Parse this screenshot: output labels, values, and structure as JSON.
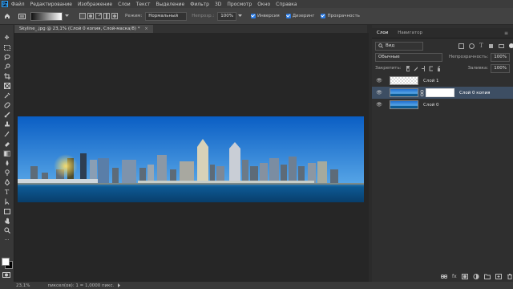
{
  "menu": {
    "logo": "Ps",
    "items": [
      "Файл",
      "Редактирование",
      "Изображение",
      "Слои",
      "Текст",
      "Выделение",
      "Фильтр",
      "3D",
      "Просмотр",
      "Окно",
      "Справка"
    ]
  },
  "options": {
    "mode_label": "Режим:",
    "mode_value": "Нормальный",
    "opacity_label": "Непрозр.:",
    "opacity_value": "100%",
    "inversion": "Инверсия",
    "dithering": "Дизеринг",
    "transparency": "Прозрачность"
  },
  "document": {
    "tab_title": "Skyline_.jpg @ 23,1% (Слой 0 копия, Слой-маска/8) *",
    "close": "×"
  },
  "layers_panel": {
    "tabs": [
      "Слои",
      "Навигатор"
    ],
    "menu_glyph": "≡",
    "filter_label": "Вид",
    "blend_mode": "Обычные",
    "opacity_label": "Непрозрачность:",
    "opacity_value": "100%",
    "lock_label": "Закрепить:",
    "fill_label": "Заливка:",
    "fill_value": "100%",
    "layers": [
      {
        "name": "Слой 1"
      },
      {
        "name": "Слой 0 копия"
      },
      {
        "name": "Слой 0"
      }
    ]
  },
  "status": {
    "zoom": "23,1%",
    "info": "пиксел(ов): 1 = 1,0000 пикс."
  },
  "colors": {
    "accent": "#31a8ff",
    "sky_top": "#0a5ec4",
    "sky_bottom": "#6bb8ef",
    "water": "#0b4f86",
    "selected_layer": "#3d4e63"
  }
}
